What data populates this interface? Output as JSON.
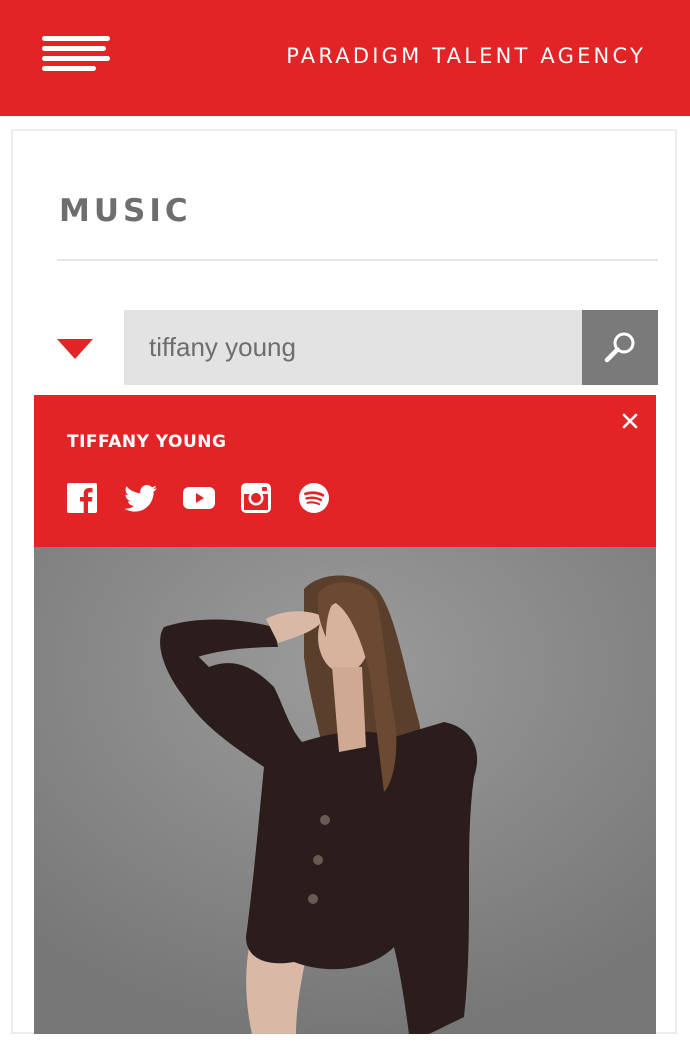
{
  "header": {
    "brand": "PARADIGM TALENT AGENCY",
    "menu_icon": "hamburger-menu-icon",
    "background_color": "#e32427"
  },
  "page": {
    "section_title": "MUSIC"
  },
  "search": {
    "value": "tiffany young",
    "placeholder": "",
    "dropdown_icon": "triangle-down-icon",
    "button_icon": "search-icon"
  },
  "result": {
    "artist_name": "TIFFANY YOUNG",
    "close_icon": "close-icon",
    "social_icons": [
      "facebook-icon",
      "twitter-icon",
      "youtube-icon",
      "instagram-icon",
      "spotify-icon"
    ]
  },
  "photo": {
    "subject": "artist-photo"
  },
  "colors": {
    "accent": "#e32427",
    "search_bg": "#e3e3e3",
    "search_button": "#7a7a7a",
    "title_gray": "#6e6e6e"
  }
}
